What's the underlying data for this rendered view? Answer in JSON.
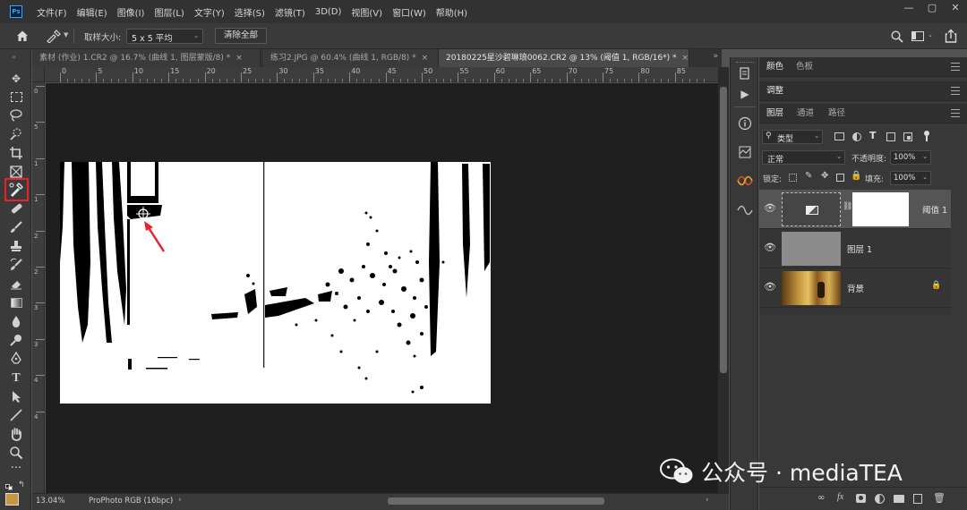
{
  "app": {
    "logo": "Ps"
  },
  "menu": [
    "文件(F)",
    "编辑(E)",
    "图像(I)",
    "图层(L)",
    "文字(Y)",
    "选择(S)",
    "滤镜(T)",
    "3D(D)",
    "视图(V)",
    "窗口(W)",
    "帮助(H)"
  ],
  "options": {
    "sample_size_label": "取样大小:",
    "sample_size_value": "5 x 5 平均",
    "clear_all": "清除全部"
  },
  "tabs": [
    {
      "label": "素材 (作业) 1.CR2 @ 16.7% (曲线 1, 图层蒙版/8) *",
      "close": "×",
      "active": false
    },
    {
      "label": "练习2.JPG @ 60.4% (曲线 1, RGB/8) *",
      "close": "×",
      "active": false
    },
    {
      "label": "20180225星沙碧琳琅0062.CR2 @ 13% (阈值 1, RGB/16*) *",
      "close": "×",
      "active": true
    }
  ],
  "ruler_top": [
    "0",
    "5",
    "10",
    "15",
    "20",
    "25",
    "30",
    "35",
    "40",
    "45",
    "50",
    "55",
    "60",
    "65",
    "70",
    "75",
    "80",
    "85"
  ],
  "ruler_left": [
    "0",
    "5",
    "1",
    "1",
    "2",
    "2",
    "3",
    "3",
    "4",
    "4"
  ],
  "status": {
    "zoom": "13.04%",
    "profile": "ProPhoto RGB (16bpc)"
  },
  "panels": {
    "color_tabs": [
      "颜色",
      "色板"
    ],
    "adjust_tab": "调整",
    "layers_tabs": [
      "图层",
      "通道",
      "路径"
    ],
    "filter_kind": "类型",
    "blend_mode": "正常",
    "opacity_label": "不透明度:",
    "opacity_value": "100%",
    "lock_label": "锁定:",
    "fill_label": "填充:",
    "fill_value": "100%",
    "layers": [
      {
        "name": "阈值 1",
        "type": "adjustment",
        "selected": true
      },
      {
        "name": "图层 1",
        "type": "gray",
        "selected": false
      },
      {
        "name": "背景",
        "type": "photo",
        "locked": true,
        "selected": false
      }
    ],
    "footer_icons": [
      "link-icon",
      "fx-icon",
      "mask-icon",
      "adjustment-icon",
      "group-icon",
      "new-layer-icon",
      "trash-icon"
    ]
  },
  "watermark": "公众号 · mediaTEA",
  "colors": {
    "accent_red": "#e8212a",
    "swatch_fg": "#c8963e",
    "bg": "#535353"
  }
}
